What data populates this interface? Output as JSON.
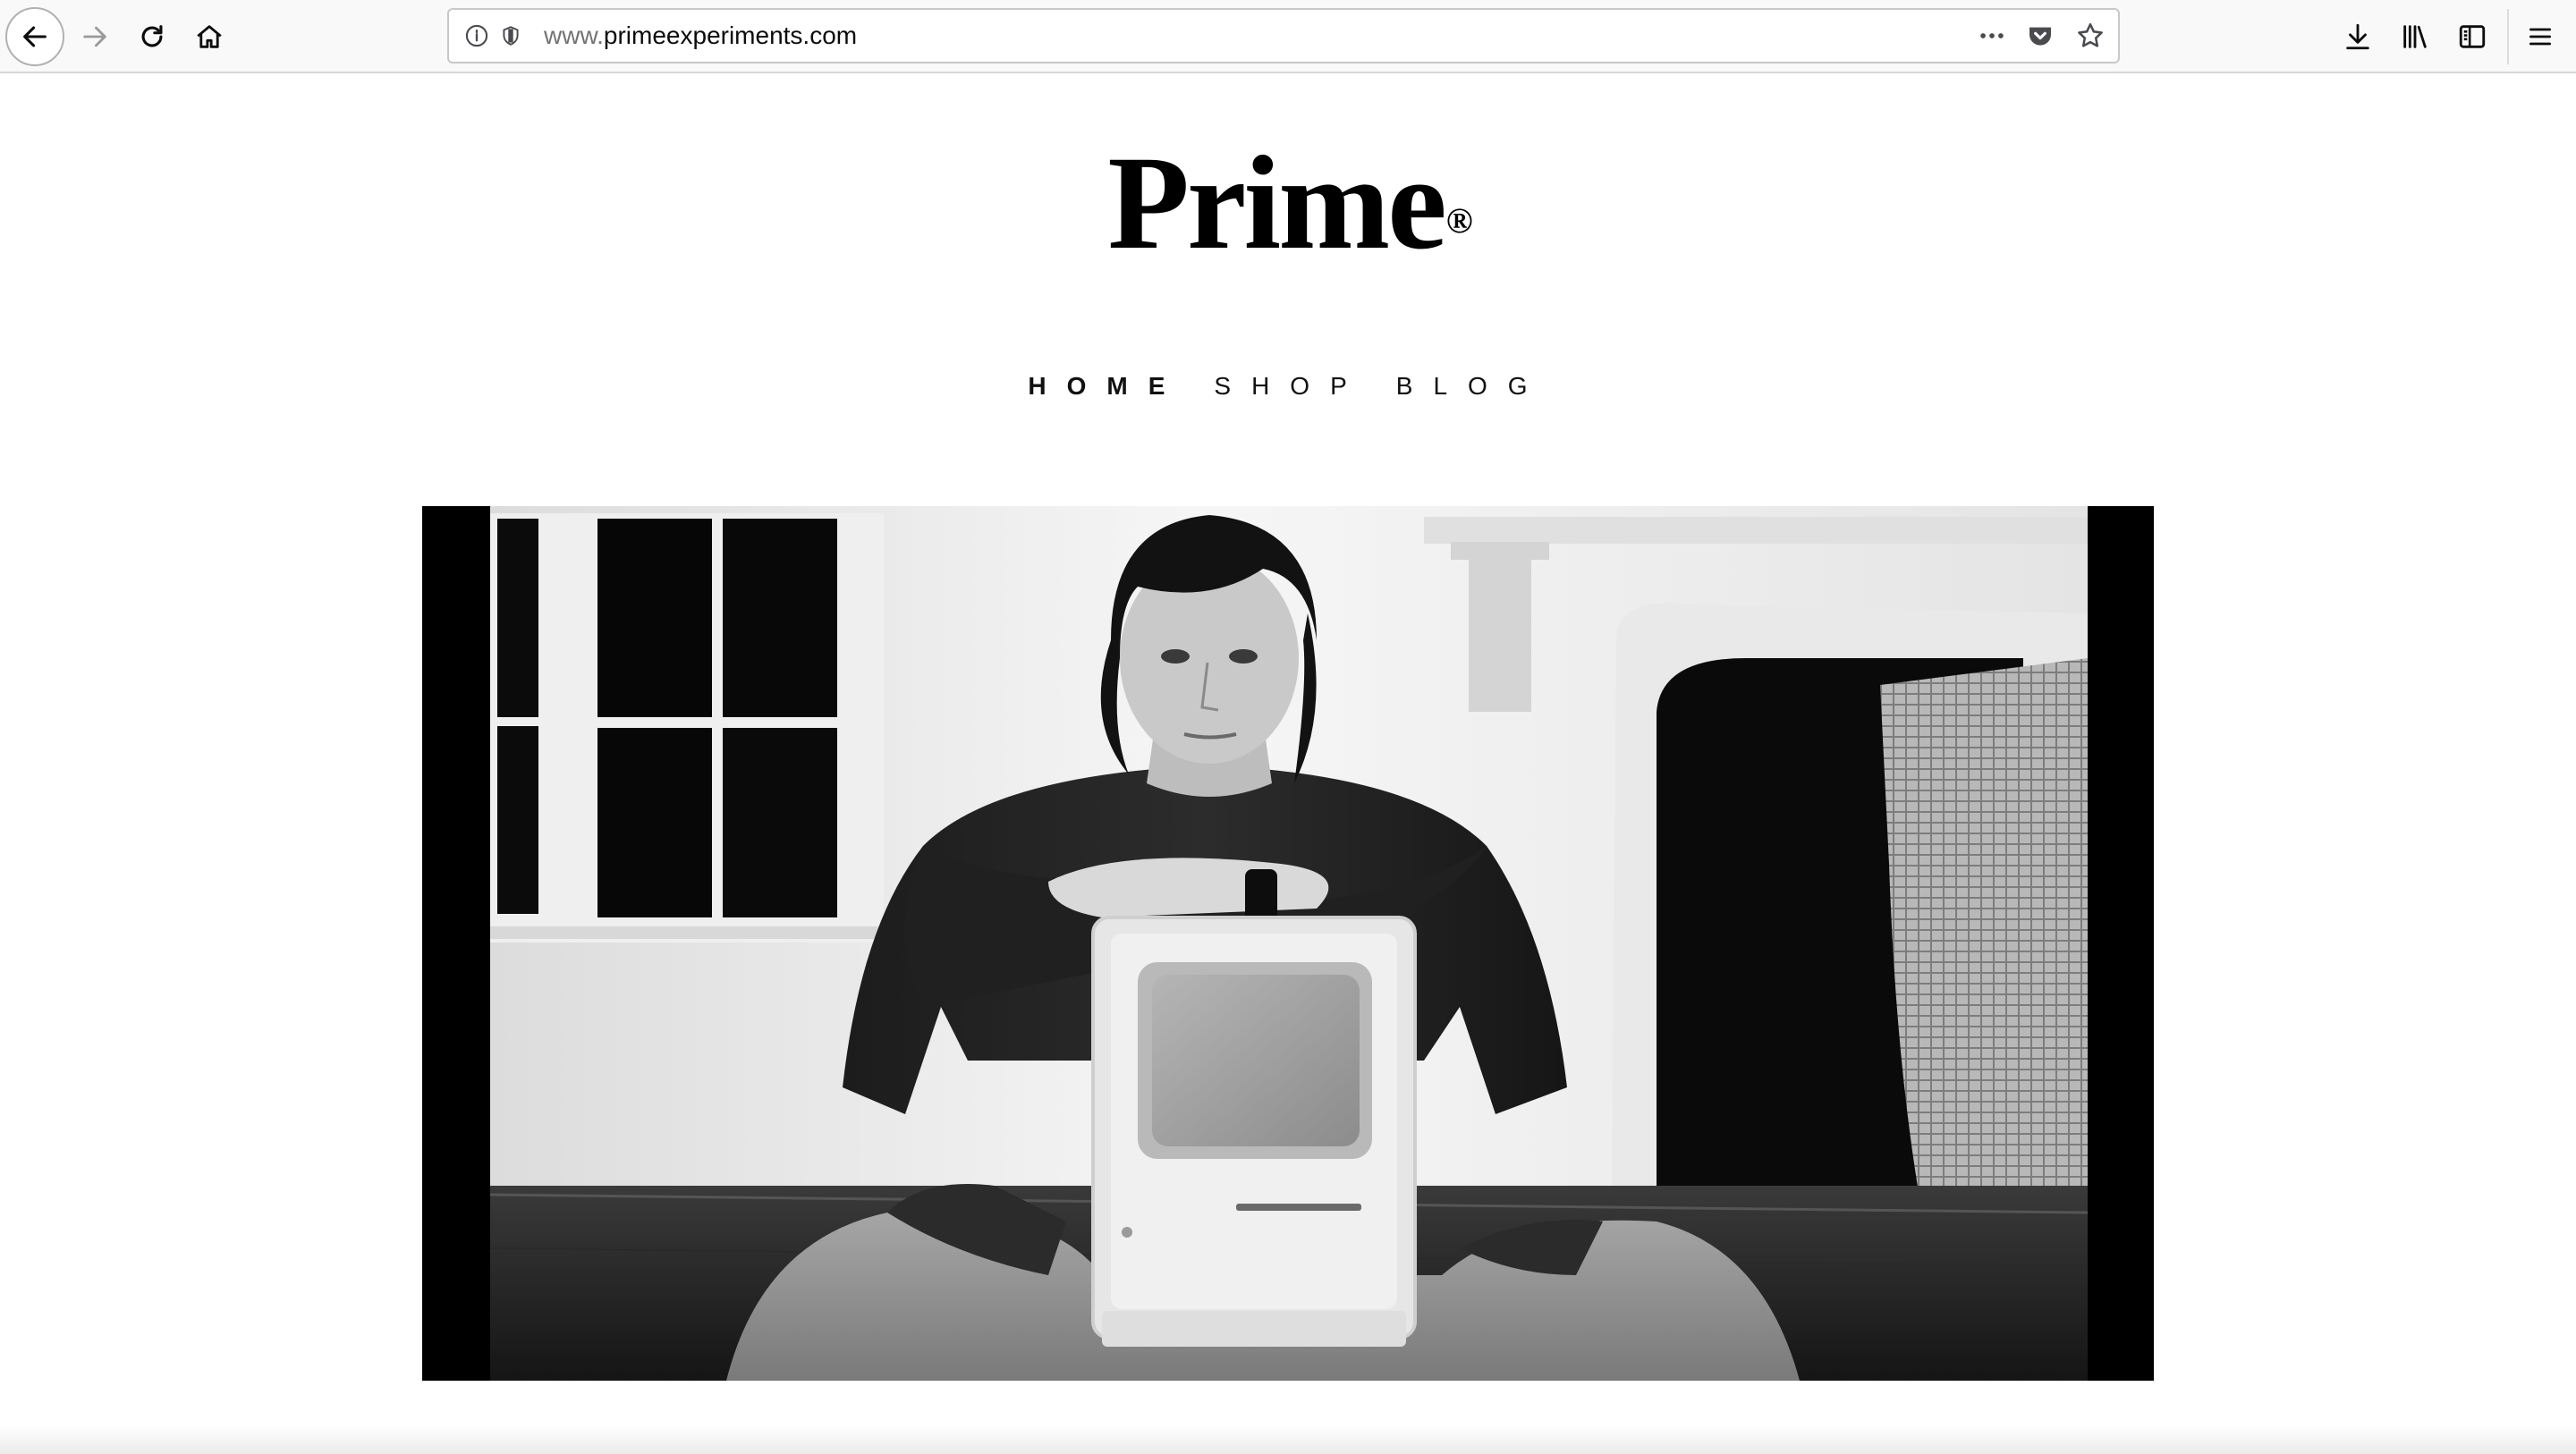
{
  "browser": {
    "url_prefix": "www.",
    "url_domain": "primeexperiments.com",
    "icons": {
      "back": "arrow-left-icon",
      "forward": "arrow-right-icon",
      "reload": "reload-icon",
      "home": "home-icon",
      "site_info": "info-icon",
      "tracking": "shield-icon",
      "page_actions": "more-dots-icon",
      "pocket": "pocket-icon",
      "bookmark": "star-icon",
      "downloads": "download-icon",
      "library": "library-icon",
      "sidebar": "sidebar-icon",
      "menu": "hamburger-icon"
    }
  },
  "site": {
    "logo": "Prime",
    "logo_mark": "®",
    "nav": [
      {
        "label": "HOME",
        "active": true
      },
      {
        "label": "SHOP",
        "active": false
      },
      {
        "label": "BLOG",
        "active": false
      }
    ]
  },
  "colors": {
    "toolbar_bg": "#f9f9fa",
    "text": "#000000",
    "url_dim": "#737373"
  }
}
